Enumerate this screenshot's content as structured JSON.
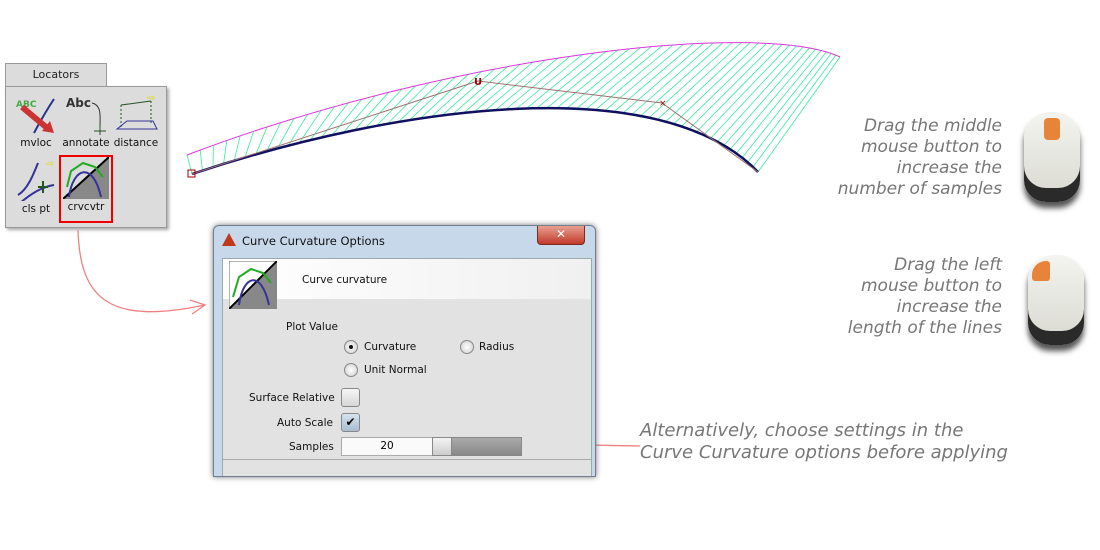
{
  "palette": {
    "tab": "Locators",
    "tools": [
      {
        "label": "mvloc",
        "icon": "move-locator-icon"
      },
      {
        "label": "annotate",
        "icon": "annotate-icon"
      },
      {
        "label": "distance",
        "icon": "distance-icon"
      },
      {
        "label": "cls pt",
        "icon": "closest-point-icon"
      },
      {
        "label": "crvcvtr",
        "icon": "curve-curvature-icon",
        "selected": true
      }
    ]
  },
  "dialog": {
    "title": "Curve Curvature Options",
    "close": "✕",
    "header": "Curve curvature",
    "plot_value_label": "Plot Value",
    "options": [
      {
        "label": "Curvature",
        "selected": true
      },
      {
        "label": "Radius",
        "selected": false
      },
      {
        "label": "Unit Normal",
        "selected": false
      }
    ],
    "surface_relative_label": "Surface Relative",
    "surface_relative": false,
    "auto_scale_label": "Auto Scale",
    "auto_scale": true,
    "samples_label": "Samples",
    "samples": "20"
  },
  "hints": {
    "middle": [
      "Drag the middle",
      "mouse button to",
      "increase the",
      "number of samples"
    ],
    "left": [
      "Drag the left",
      "mouse button to",
      "increase the",
      "length of the lines"
    ],
    "alt": [
      "Alternatively, choose settings in the",
      "Curve Curvature options before applying"
    ]
  },
  "colors": {
    "accent": "#e00000",
    "comb": "#33ee99",
    "outer": "#dd33dd",
    "curve": "#101060",
    "hull": "#a07070",
    "arrow": "#f08080"
  }
}
